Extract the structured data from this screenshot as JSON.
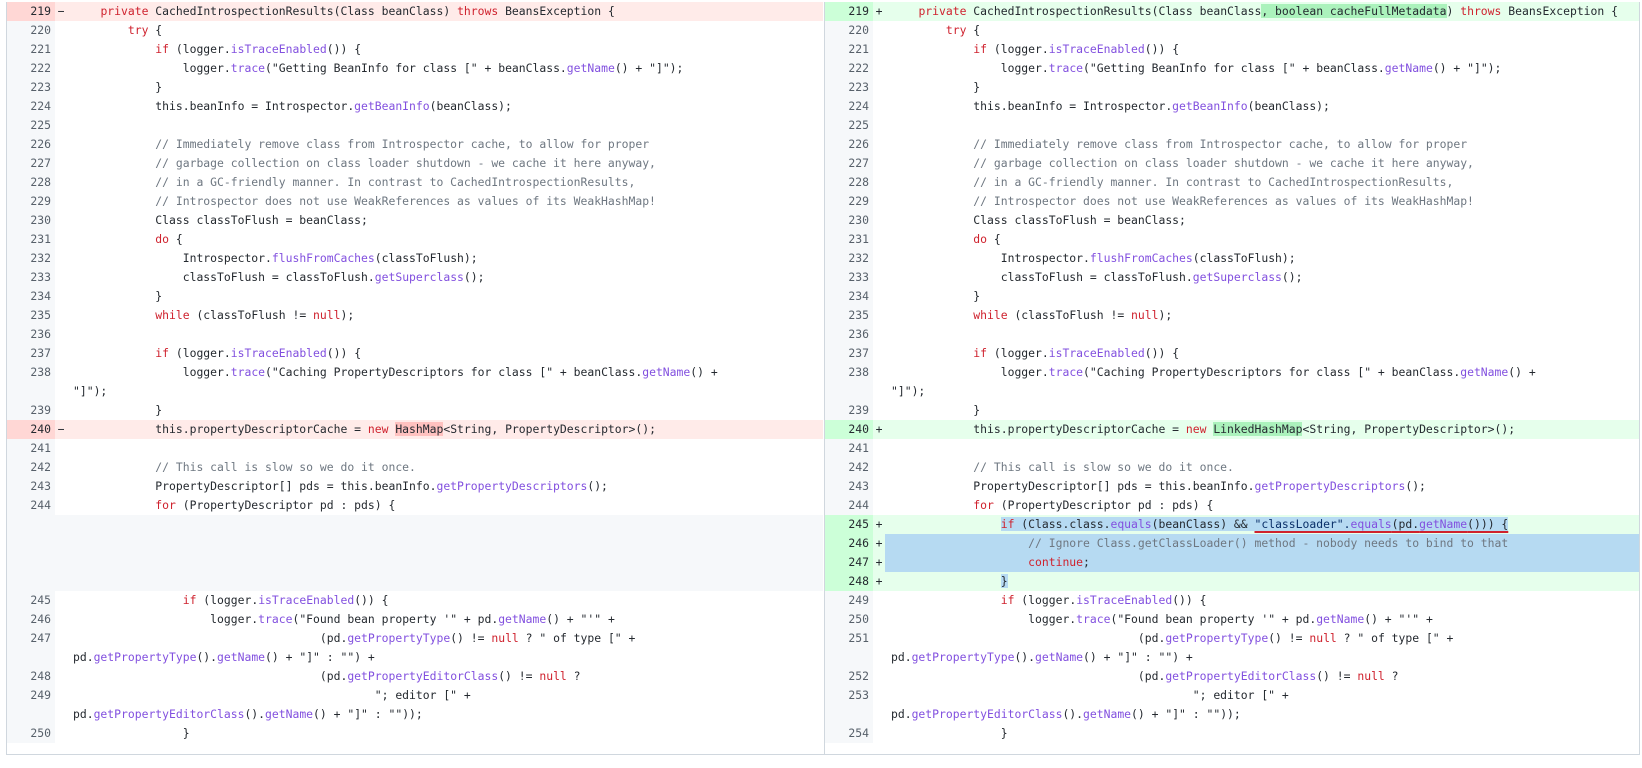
{
  "left": {
    "rows": [
      {
        "num": "219",
        "type": "del",
        "sign": "−",
        "seg": [
          [
            "    private ",
            ""
          ],
          [
            "Cached",
            "k"
          ],
          [
            "",
            ""
          ]
        ]
      }
    ]
  }
}
